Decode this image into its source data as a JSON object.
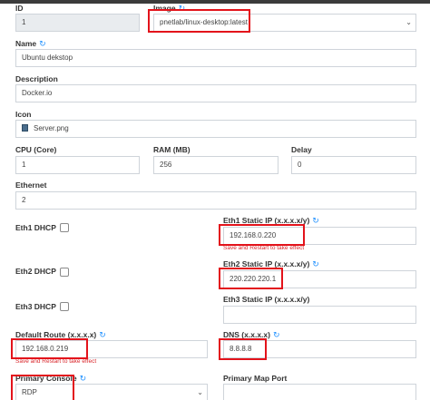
{
  "form": {
    "id": {
      "label": "ID",
      "value": "1"
    },
    "image": {
      "label": "Image",
      "value": "pnetlab/linux-desktop:latest",
      "caret": "⌄"
    },
    "name": {
      "label": "Name",
      "value": "Ubuntu dekstop"
    },
    "description": {
      "label": "Description",
      "value": "Docker.io"
    },
    "icon": {
      "label": "Icon",
      "value": "Server.png"
    },
    "cpu": {
      "label": "CPU (Core)",
      "value": "1"
    },
    "ram": {
      "label": "RAM (MB)",
      "value": "256"
    },
    "delay": {
      "label": "Delay",
      "value": "0"
    },
    "ethernet": {
      "label": "Ethernet",
      "value": "2"
    },
    "eth1_dhcp": {
      "label": "Eth1 DHCP"
    },
    "eth2_dhcp": {
      "label": "Eth2 DHCP"
    },
    "eth3_dhcp": {
      "label": "Eth3 DHCP"
    },
    "eth1_static": {
      "label": "Eth1 Static IP (x.x.x.x/y)",
      "value": "192.168.0.220",
      "warning": "Save and Restart to take effect"
    },
    "eth2_static": {
      "label": "Eth2 Static IP (x.x.x.x/y)",
      "value": "220.220.220.1"
    },
    "eth3_static": {
      "label": "Eth3 Static IP (x.x.x.x/y)",
      "value": ""
    },
    "default_route": {
      "label": "Default Route (x.x.x.x)",
      "value": "192.168.0.219",
      "warning": "Save and Restart to take effect"
    },
    "dns": {
      "label": "DNS (x.x.x.x)",
      "value": "8.8.8.8"
    },
    "primary_console": {
      "label": "Primary Console",
      "value": "RDP",
      "caret": "⌄"
    },
    "primary_map_port": {
      "label": "Primary Map Port",
      "value": ""
    }
  },
  "icons": {
    "reset": "↻"
  },
  "colors": {
    "highlight": "#e3131b",
    "accent": "#1e90ff",
    "warning": "#d9262b"
  }
}
